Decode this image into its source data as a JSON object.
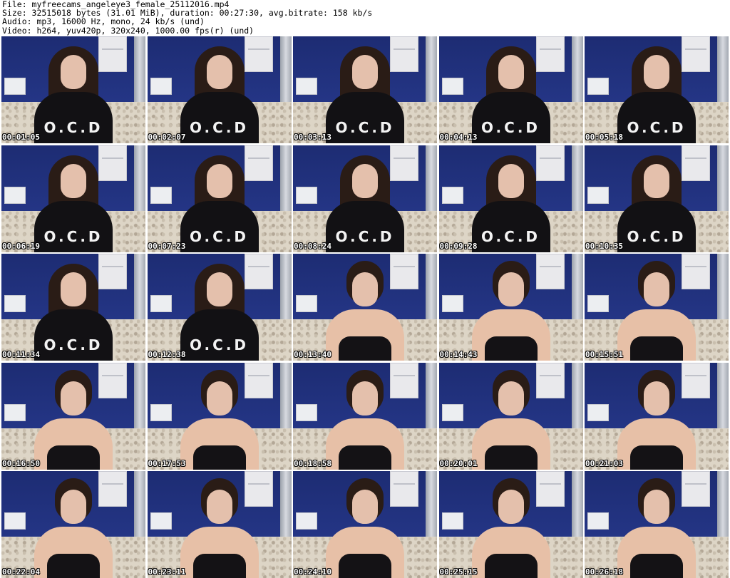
{
  "header": {
    "line1": "File: myfreecams_angeleye3_female_25112016.mp4",
    "line2": "Size: 32515018 bytes (31.01 MiB), duration: 00:27:30, avg.bitrate: 158 kb/s",
    "line3": "Audio: mp3, 16000 Hz, mono, 24 kb/s (und)",
    "line4": "Video: h264, yuv420p, 320x240, 1000.00 fps(r) (und)"
  },
  "shirt_text": "O.C.D",
  "thumbnails": [
    {
      "time": "00:01:05",
      "style": "shirt"
    },
    {
      "time": "00:02:07",
      "style": "shirt"
    },
    {
      "time": "00:03:13",
      "style": "shirt"
    },
    {
      "time": "00:04:13",
      "style": "shirt"
    },
    {
      "time": "00:05:18",
      "style": "shirt"
    },
    {
      "time": "00:06:19",
      "style": "shirt"
    },
    {
      "time": "00:07:23",
      "style": "shirt"
    },
    {
      "time": "00:08:24",
      "style": "shirt"
    },
    {
      "time": "00:09:28",
      "style": "shirt"
    },
    {
      "time": "00:10:35",
      "style": "shirt"
    },
    {
      "time": "00:11:34",
      "style": "shirt"
    },
    {
      "time": "00:12:38",
      "style": "shirt"
    },
    {
      "time": "00:13:40",
      "style": "bun"
    },
    {
      "time": "00:14:43",
      "style": "bun"
    },
    {
      "time": "00:15:51",
      "style": "bun"
    },
    {
      "time": "00:16:50",
      "style": "bun"
    },
    {
      "time": "00:17:53",
      "style": "bun"
    },
    {
      "time": "00:18:58",
      "style": "bun"
    },
    {
      "time": "00:20:01",
      "style": "bun"
    },
    {
      "time": "00:21:03",
      "style": "bun"
    },
    {
      "time": "00:22:04",
      "style": "bun"
    },
    {
      "time": "00:23:11",
      "style": "bun"
    },
    {
      "time": "00:24:10",
      "style": "bun"
    },
    {
      "time": "00:25:15",
      "style": "bun"
    },
    {
      "time": "00:26:18",
      "style": "bun"
    }
  ]
}
